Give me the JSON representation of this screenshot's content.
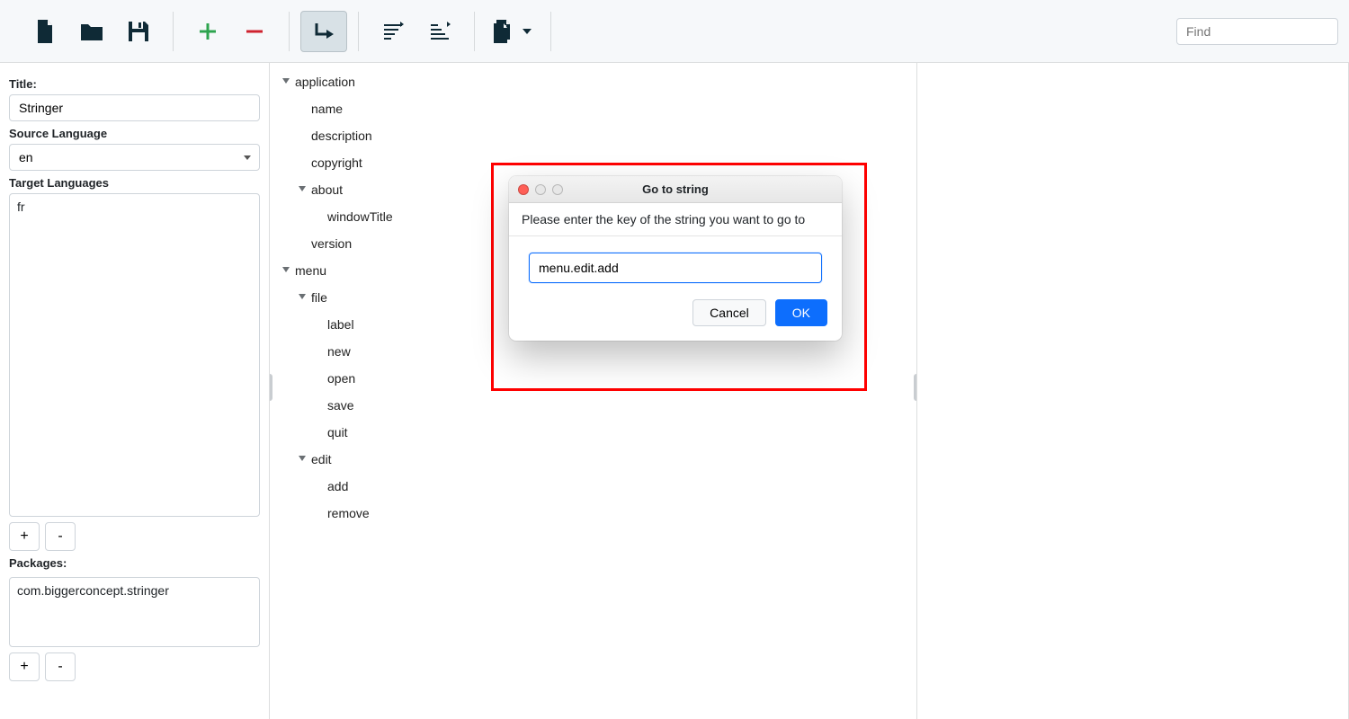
{
  "toolbar": {
    "find_placeholder": "Find"
  },
  "sidebar": {
    "title_label": "Title:",
    "title_value": "Stringer",
    "source_lang_label": "Source Language",
    "source_lang_value": "en",
    "target_lang_label": "Target Languages",
    "target_langs": [
      "fr"
    ],
    "packages_label": "Packages:",
    "packages": [
      "com.biggerconcept.stringer"
    ],
    "add_btn": "+",
    "remove_btn": "-"
  },
  "tree": {
    "items": [
      {
        "level": 0,
        "caret": true,
        "label": "application"
      },
      {
        "level": 1,
        "caret": false,
        "label": "name"
      },
      {
        "level": 1,
        "caret": false,
        "label": "description"
      },
      {
        "level": 1,
        "caret": false,
        "label": "copyright"
      },
      {
        "level": 1,
        "caret": true,
        "label": "about"
      },
      {
        "level": 2,
        "caret": false,
        "label": "windowTitle"
      },
      {
        "level": 1,
        "caret": false,
        "label": "version"
      },
      {
        "level": 0,
        "caret": true,
        "label": "menu"
      },
      {
        "level": 1,
        "caret": true,
        "label": "file"
      },
      {
        "level": 2,
        "caret": false,
        "label": "label"
      },
      {
        "level": 2,
        "caret": false,
        "label": "new"
      },
      {
        "level": 2,
        "caret": false,
        "label": "open"
      },
      {
        "level": 2,
        "caret": false,
        "label": "save"
      },
      {
        "level": 2,
        "caret": false,
        "label": "quit"
      },
      {
        "level": 1,
        "caret": true,
        "label": "edit"
      },
      {
        "level": 2,
        "caret": false,
        "label": "add"
      },
      {
        "level": 2,
        "caret": false,
        "label": "remove"
      }
    ]
  },
  "dialog": {
    "title": "Go to string",
    "message": "Please enter the key of the string you want to go to",
    "input_value": "menu.edit.add",
    "cancel": "Cancel",
    "ok": "OK"
  }
}
